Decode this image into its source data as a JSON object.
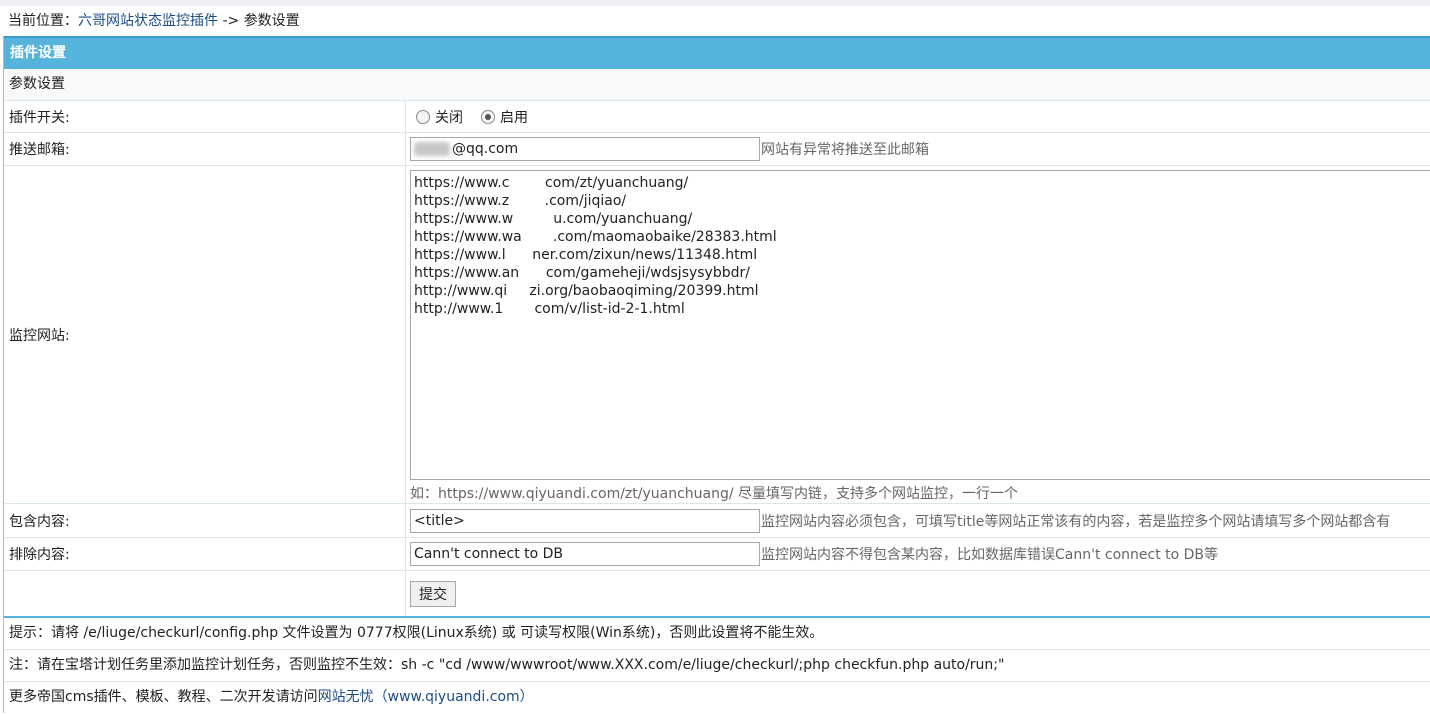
{
  "breadcrumb": {
    "prefix": "当前位置：",
    "plugin_link": "六哥网站状态监控插件",
    "separator": " -> ",
    "current": "参数设置"
  },
  "panel": {
    "header": "插件设置",
    "subheader": "参数设置"
  },
  "form": {
    "switch": {
      "label": "插件开关:",
      "options": [
        "关闭",
        "启用"
      ],
      "selected": "启用"
    },
    "email": {
      "label": "推送邮箱:",
      "value": "@qq.com",
      "hint": "网站有异常将推送至此邮箱"
    },
    "sites": {
      "label": "监控网站:",
      "value": "https://www.c        com/zt/yuanchuang/\nhttps://www.z        .com/jiqiao/\nhttps://www.w         u.com/yuanchuang/\nhttps://www.wa       .com/maomaobaike/28383.html\nhttps://www.l      ner.com/zixun/news/11348.html\nhttps://www.an      com/gameheji/wdsjsysybbdr/\nhttp://www.qi     zi.org/baobaoqiming/20399.html\nhttp://www.1       com/v/list-id-2-1.html",
      "hint": "如：https://www.qiyuandi.com/zt/yuanchuang/ 尽量填写内链，支持多个网站监控，一行一个"
    },
    "include": {
      "label": "包含内容:",
      "value": "<title>",
      "hint": "监控网站内容必须包含，可填写title等网站正常该有的内容，若是监控多个网站请填写多个网站都含有"
    },
    "exclude": {
      "label": "排除内容:",
      "value": "Cann't connect to DB",
      "hint": "监控网站内容不得包含某内容，比如数据库错误Cann't connect to DB等"
    },
    "submit_label": "提交"
  },
  "footer": {
    "tip": "提示：请将 /e/liuge/checkurl/config.php 文件设置为 0777权限(Linux系统) 或 可读写权限(Win系统)，否则此设置将不能生效。",
    "note": "注：请在宝塔计划任务里添加监控计划任务，否则监控不生效：sh -c \"cd /www/wwwroot/www.XXX.com/e/liuge/checkurl/;php checkfun.php auto/run;\"",
    "more_prefix": "更多帝国cms插件、模板、教程、二次开发请访问",
    "more_link": "网站无忧（www.qiyuandi.com）"
  }
}
